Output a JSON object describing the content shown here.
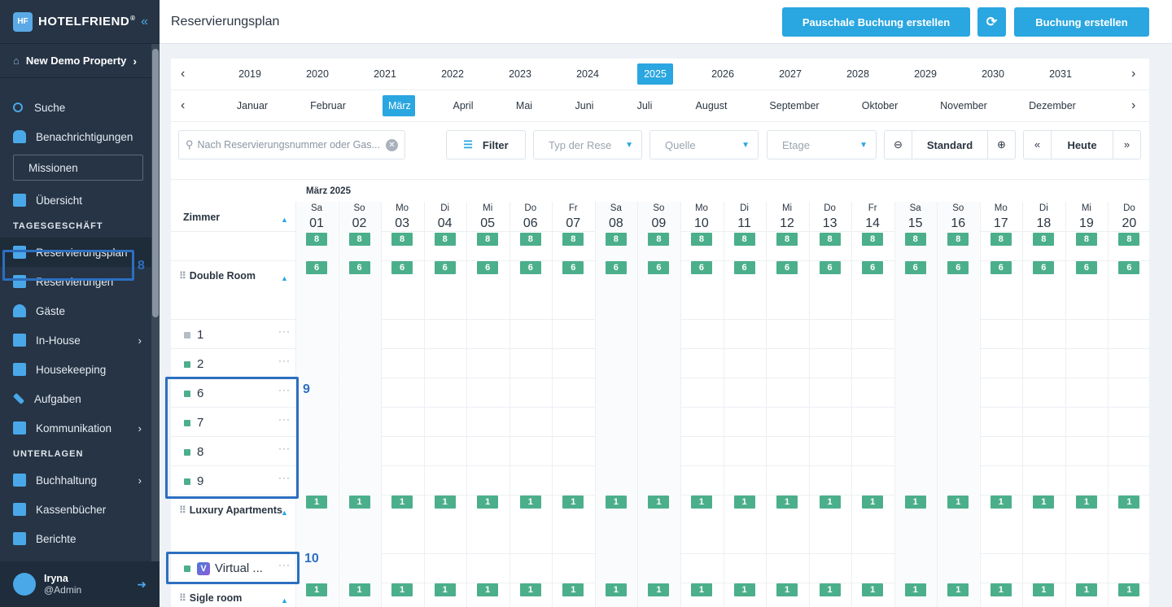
{
  "sidebar": {
    "brand": "HOTELFRIEND",
    "brand_reg": "®",
    "property": "New Demo Property",
    "items": {
      "suche": "Suche",
      "benachrichtigungen": "Benachrichtigungen",
      "missionen": "Missionen",
      "uebersicht": "Übersicht",
      "reservierungsplan": "Reservierungsplan",
      "reservierungen": "Reservierungen",
      "gaeste": "Gäste",
      "inhouse": "In-House",
      "housekeeping": "Housekeeping",
      "aufgaben": "Aufgaben",
      "kommunikation": "Kommunikation",
      "buchhaltung": "Buchhaltung",
      "kassenbuecher": "Kassenbücher",
      "berichte": "Berichte"
    },
    "sections": {
      "tagesgeschaeft": "TAGESGESCHÄFT",
      "unterlagen": "UNTERLAGEN"
    },
    "user": {
      "name": "Iryna",
      "role": "@Admin"
    }
  },
  "header": {
    "title": "Reservierungsplan",
    "btn_pauschal": "Pauschale Buchung erstellen",
    "btn_buchung": "Buchung erstellen"
  },
  "years": [
    "2019",
    "2020",
    "2021",
    "2022",
    "2023",
    "2024",
    "2025",
    "2026",
    "2027",
    "2028",
    "2029",
    "2030",
    "2031"
  ],
  "selected_year": "2025",
  "months": [
    "Januar",
    "Februar",
    "März",
    "April",
    "Mai",
    "Juni",
    "Juli",
    "August",
    "September",
    "Oktober",
    "November",
    "Dezember"
  ],
  "selected_month": "März",
  "filters": {
    "search_placeholder": "Nach Reservierungsnummer oder Gas...",
    "filter": "Filter",
    "type": "Typ der Rese",
    "source": "Quelle",
    "floor": "Etage",
    "zoom": "Standard",
    "today": "Heute"
  },
  "grid": {
    "month_label": "März 2025",
    "rooms_header": "Zimmer",
    "days": [
      {
        "d": "Sa",
        "n": "01"
      },
      {
        "d": "So",
        "n": "02"
      },
      {
        "d": "Mo",
        "n": "03"
      },
      {
        "d": "Di",
        "n": "04"
      },
      {
        "d": "Mi",
        "n": "05"
      },
      {
        "d": "Do",
        "n": "06"
      },
      {
        "d": "Fr",
        "n": "07"
      },
      {
        "d": "Sa",
        "n": "08"
      },
      {
        "d": "So",
        "n": "09"
      },
      {
        "d": "Mo",
        "n": "10"
      },
      {
        "d": "Di",
        "n": "11"
      },
      {
        "d": "Mi",
        "n": "12"
      },
      {
        "d": "Do",
        "n": "13"
      },
      {
        "d": "Fr",
        "n": "14"
      },
      {
        "d": "Sa",
        "n": "15"
      },
      {
        "d": "So",
        "n": "16"
      },
      {
        "d": "Mo",
        "n": "17"
      },
      {
        "d": "Di",
        "n": "18"
      },
      {
        "d": "Mi",
        "n": "19"
      },
      {
        "d": "Do",
        "n": "20"
      }
    ],
    "total_avail": "8",
    "categories": [
      {
        "name": "Double Room",
        "avail": "6",
        "rooms": [
          "1",
          "2",
          "6",
          "7",
          "8",
          "9"
        ]
      },
      {
        "name": "Luxury Apartments",
        "avail": "1",
        "rooms": [
          "Virtual ..."
        ]
      },
      {
        "name": "Sigle room",
        "avail": "1",
        "rooms": []
      }
    ]
  },
  "annotations": {
    "a8": "8",
    "a9": "9",
    "a10": "10"
  }
}
